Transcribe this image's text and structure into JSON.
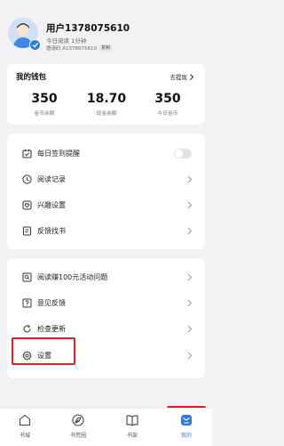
{
  "profile": {
    "username": "用户1378075610",
    "reading_time": "今日阅读 1分钟",
    "invite_code": "邀请码 A1378075610",
    "copy_label": "复制"
  },
  "wallet": {
    "title": "我的钱包",
    "withdraw_label": "去提现",
    "stats": [
      {
        "value": "350",
        "label": "金币余额"
      },
      {
        "value": "18.70",
        "label": "现金余额"
      },
      {
        "value": "350",
        "label": "今日金币"
      }
    ]
  },
  "menu_group_1": [
    {
      "label": "每日签到提醒",
      "icon": "calendar-check-icon",
      "control": "toggle",
      "toggle_on": false
    },
    {
      "label": "阅读记录",
      "icon": "clock-icon"
    },
    {
      "label": "兴趣设置",
      "icon": "heart-shield-icon"
    },
    {
      "label": "反馈找书",
      "icon": "document-icon"
    }
  ],
  "menu_group_2": [
    {
      "label": "阅读赚100元活动问题",
      "icon": "search-card-icon"
    },
    {
      "label": "意见反馈",
      "icon": "question-icon"
    },
    {
      "label": "检查更新",
      "icon": "refresh-icon"
    },
    {
      "label": "设置",
      "icon": "gear-icon"
    }
  ],
  "tabbar": [
    {
      "label": "书城",
      "icon": "home-icon",
      "active": false
    },
    {
      "label": "书荒圈",
      "icon": "leaf-icon",
      "active": false
    },
    {
      "label": "书架",
      "icon": "book-icon",
      "active": false
    },
    {
      "label": "我的",
      "icon": "profile-face-icon",
      "active": true
    }
  ],
  "colors": {
    "accent": "#2b7be0",
    "highlight": "#e02020",
    "background": "#f2f2f4"
  }
}
